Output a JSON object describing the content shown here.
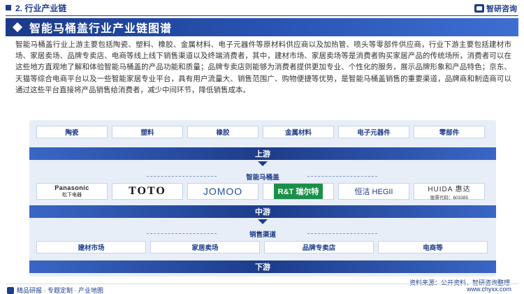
{
  "header": {
    "section": "2. 行业产业链",
    "logo_text": "智研咨询"
  },
  "title": "智能马桶盖行业产业链图谱",
  "intro": "智能马桶盖行业上游主要包括陶瓷、塑料、橡胶、金属材料、电子元器件等原材料供应商以及加热管、喷头等零部件供应商，行业下游主要包括建材市场、家居卖场、品牌专卖店、电商等线上线下销售渠道以及终端消费者，其中，建材市场、家居卖场等是消费者购买家居产品的传统场所，消费者可以在这些地方直观地了解和体验智能马桶盖的产品功能和质量；品牌专卖店则能够为消费者提供更加专业、个性化的服务，展示品牌形象和产品特色；京东、天猫等综合电商平台以及一些智能家居专业平台，具有用户流量大、销售范围广、购物便捷等优势，是智能马桶盖销售的重要渠道，品牌商和制造商可以通过这些平台直接将产品销售给消费者，减少中间环节，降低销售成本。",
  "upstream": {
    "items": [
      "陶瓷",
      "塑料",
      "橡胶",
      "金属材料",
      "电子元器件",
      "零部件"
    ],
    "band": "上游"
  },
  "midstream": {
    "label": "智能马桶盖",
    "brands": [
      {
        "name": "Panasonic",
        "sub": "松下电器"
      },
      {
        "name": "TOTO",
        "sub": ""
      },
      {
        "name": "JOMOO",
        "sub": ""
      },
      {
        "name": "R&T 瑞尔特",
        "sub": ""
      },
      {
        "name": "恒洁 HEGII",
        "sub": ""
      },
      {
        "name": "HUIDA 惠达",
        "sub": "股票代码：603385"
      }
    ],
    "band": "中游"
  },
  "downstream": {
    "label": "销售渠道",
    "items": [
      "建材市场",
      "家居卖场",
      "品牌专卖店",
      "电商等"
    ],
    "band": "下游"
  },
  "source": "资料来源：公开资料、智研咨询整理",
  "footer": {
    "left": "精品研报 · 专题定制 · 产业地图",
    "right": "www.chyxx.com"
  },
  "colors": {
    "brand_blue": "#1d3c8a",
    "panel_bg": "#e8eef8"
  }
}
